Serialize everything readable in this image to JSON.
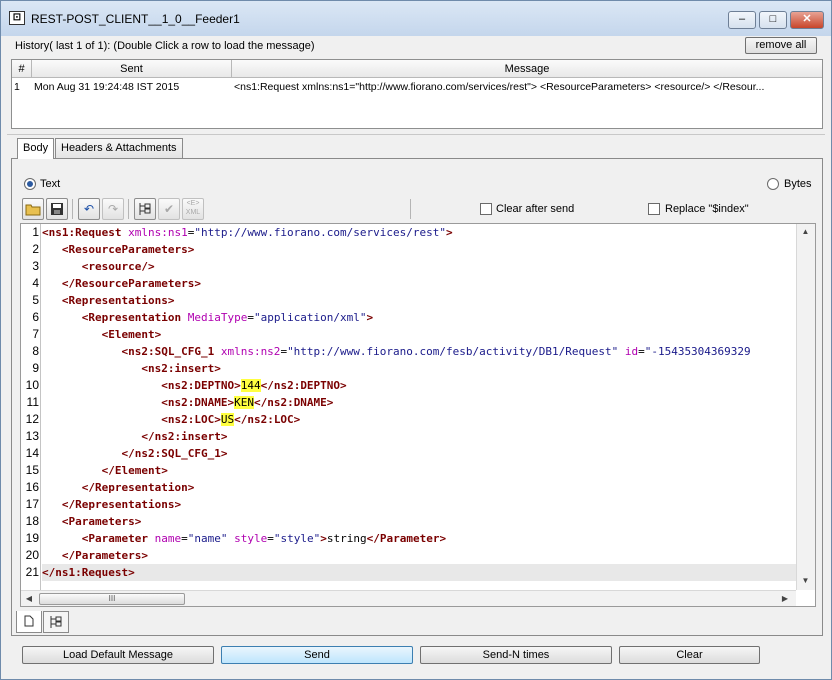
{
  "window": {
    "title": "REST-POST_CLIENT__1_0__Feeder1",
    "controls": {
      "minimize": "–",
      "maximize": "□",
      "close": "✕"
    }
  },
  "history": {
    "label": "History( last 1 of 1):    (Double Click a row to load the message)",
    "remove_all": "remove all",
    "columns": [
      "#",
      "Sent",
      "Message"
    ],
    "rows": [
      {
        "num": "1",
        "sent": "Mon Aug 31 19:24:48 IST 2015",
        "message": "<ns1:Request xmlns:ns1=\"http://www.fiorano.com/services/rest\">   <ResourceParameters>        <resource/>    </Resour..."
      }
    ]
  },
  "tabs": [
    "Body",
    "Headers & Attachments"
  ],
  "body": {
    "text_label": "Text",
    "bytes_label": "Bytes",
    "mode": "Text",
    "clear_after_send": "Clear after send",
    "replace_index": "Replace \"$index\""
  },
  "icons": {
    "open": "open-folder-icon",
    "save": "save-icon",
    "undo": "undo-icon",
    "redo": "redo-icon",
    "xml_tree": "xml-tree-icon",
    "validate": "checkmark-icon",
    "xml_format": "xml-format-icon"
  },
  "editor": {
    "line_numbers": [
      "1",
      "2",
      "3",
      "4",
      "5",
      "6",
      "7",
      "8",
      "9",
      "10",
      "11",
      "12",
      "13",
      "14",
      "15",
      "16",
      "17",
      "18",
      "19",
      "20",
      "21"
    ],
    "current_line": 21,
    "scroll_thumb": "III"
  },
  "buttons": {
    "load_default": "Load Default Message",
    "send": "Send",
    "send_n": "Send-N times",
    "clear": "Clear"
  }
}
